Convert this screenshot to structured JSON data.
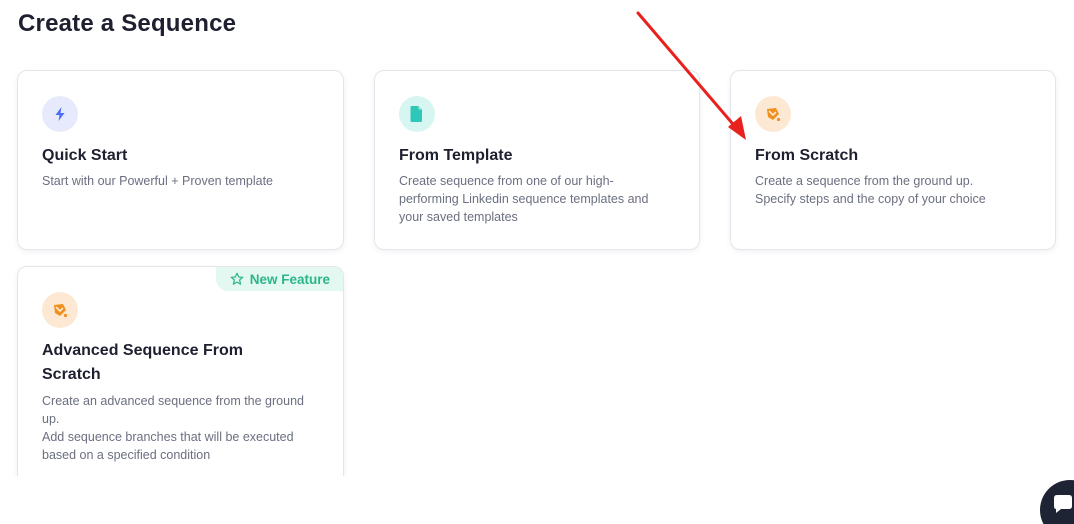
{
  "page": {
    "title": "Create a Sequence"
  },
  "cards": [
    {
      "id": "quick-start",
      "icon": "lightning-icon",
      "icon_color": "#4a6cf7",
      "title": "Quick Start",
      "description": "Start with our Powerful + Proven template"
    },
    {
      "id": "from-template",
      "icon": "document-icon",
      "icon_color": "#2fc7b8",
      "title": "From Template",
      "description": "Create sequence from one of our high-performing Linkedin sequence templates and your saved templates"
    },
    {
      "id": "from-scratch",
      "icon": "pen-tool-icon",
      "icon_color": "#f0901e",
      "title": "From Scratch",
      "description": "Create a sequence from the ground up.\nSpecify steps and the copy of your choice"
    },
    {
      "id": "advanced-from-scratch",
      "icon": "pen-tool-icon",
      "icon_color": "#f0901e",
      "title": "Advanced Sequence From Scratch",
      "description": "Create an advanced sequence from the ground up.\nAdd sequence branches that will be executed based on a specified condition",
      "badge": "New Feature"
    }
  ],
  "annotation": {
    "arrow_color": "#e8201e"
  },
  "chat_widget": {
    "icon": "chat-icon"
  }
}
